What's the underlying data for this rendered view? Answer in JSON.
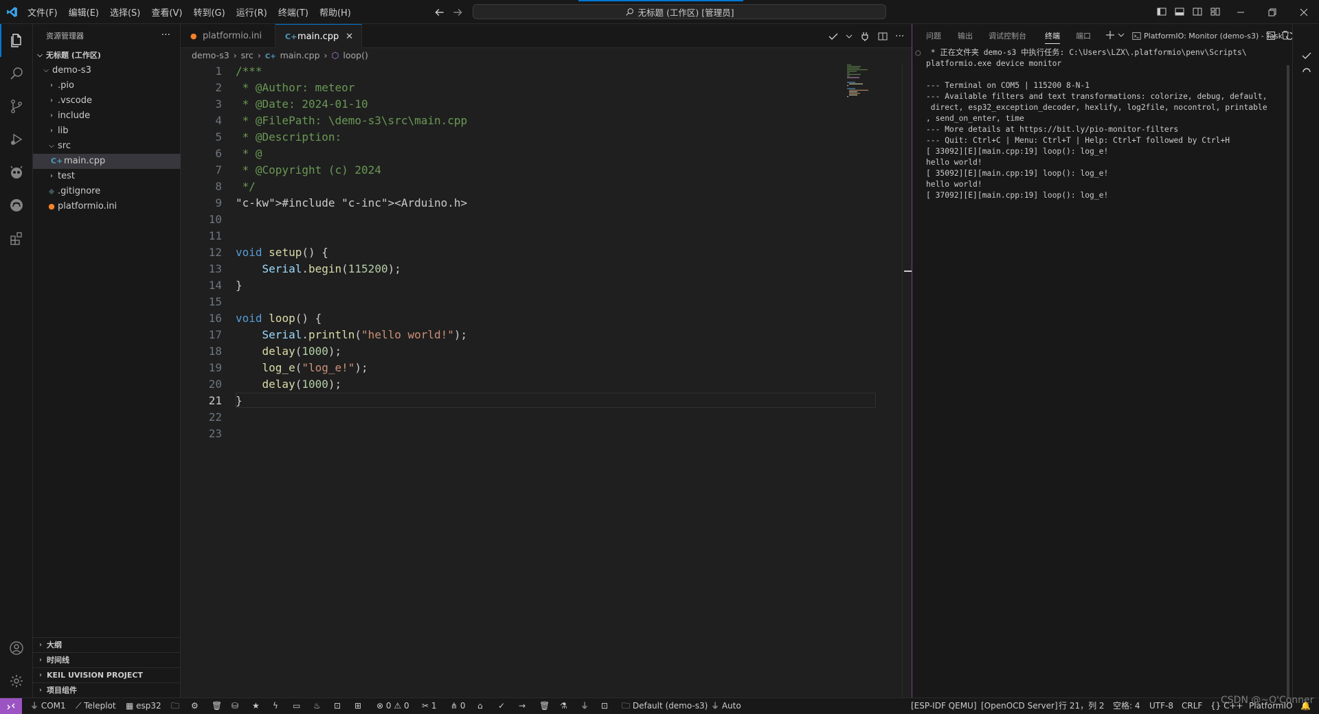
{
  "titlebar": {
    "menu": [
      "文件(F)",
      "编辑(E)",
      "选择(S)",
      "查看(V)",
      "转到(G)",
      "运行(R)",
      "终端(T)",
      "帮助(H)"
    ],
    "command_center": "无标题 (工作区) [管理员]"
  },
  "explorer": {
    "title": "资源管理器",
    "more": "···",
    "root": "无标题 (工作区)",
    "tree": [
      {
        "label": "demo-s3",
        "depth": 1,
        "chevron": "down"
      },
      {
        "label": ".pio",
        "depth": 2,
        "chevron": "right"
      },
      {
        "label": ".vscode",
        "depth": 2,
        "chevron": "right"
      },
      {
        "label": "include",
        "depth": 2,
        "chevron": "right"
      },
      {
        "label": "lib",
        "depth": 2,
        "chevron": "right"
      },
      {
        "label": "src",
        "depth": 2,
        "chevron": "down"
      },
      {
        "label": "main.cpp",
        "depth": 3,
        "icon": "cpp-file-icon"
      },
      {
        "label": "test",
        "depth": 2,
        "chevron": "right"
      },
      {
        "label": ".gitignore",
        "depth": 2,
        "icon": "git-file-icon"
      },
      {
        "label": "platformio.ini",
        "depth": 2,
        "icon": "platformio-file-icon"
      }
    ],
    "sections": [
      "大纲",
      "时间线",
      "KEIL UVISION PROJECT",
      "项目组件"
    ]
  },
  "editor": {
    "tabs": [
      {
        "label": "platformio.ini",
        "active": false
      },
      {
        "label": "main.cpp",
        "active": true,
        "close": "✕"
      }
    ],
    "breadcrumb": [
      "demo-s3",
      "src",
      "main.cpp",
      "loop()"
    ],
    "line_numbers": [
      "1",
      "2",
      "3",
      "4",
      "5",
      "6",
      "7",
      "8",
      "9",
      "10",
      "11",
      "12",
      "13",
      "14",
      "15",
      "16",
      "17",
      "18",
      "19",
      "20",
      "21",
      "22",
      "23"
    ],
    "current_line": 21,
    "code": [
      "/***",
      " * @Author: meteor",
      " * @Date: 2024-01-10",
      " * @FilePath: \\demo-s3\\src\\main.cpp",
      " * @Description:",
      " * @",
      " * @Copyright (c) 2024",
      " */",
      "#include <Arduino.h>",
      "",
      "",
      "void setup() {",
      "    Serial.begin(115200);",
      "}",
      "",
      "void loop() {",
      "    Serial.println(\"hello world!\");",
      "    delay(1000);",
      "    log_e(\"log_e!\");",
      "    delay(1000);",
      "}",
      "",
      ""
    ]
  },
  "panel": {
    "tabs": [
      "问题",
      "输出",
      "调试控制台",
      "终端",
      "端口"
    ],
    "active_tab": "终端",
    "task_title": "PlatformIO: Monitor (demo-s3) - Task",
    "terminal_lines": [
      " * 正在文件夹 demo-s3 中执行任务: C:\\Users\\LZX\\.platformio\\penv\\Scripts\\",
      "platformio.exe device monitor",
      "",
      "--- Terminal on COM5 | 115200 8-N-1",
      "--- Available filters and text transformations: colorize, debug, default,",
      " direct, esp32_exception_decoder, hexlify, log2file, nocontrol, printable",
      ", send_on_enter, time",
      "--- More details at https://bit.ly/pio-monitor-filters",
      "--- Quit: Ctrl+C | Menu: Ctrl+T | Help: Ctrl+T followed by Ctrl+H",
      "[ 33092][E][main.cpp:19] loop(): log_e!",
      "hello world!",
      "[ 35092][E][main.cpp:19] loop(): log_e!",
      "hello world!",
      "[ 37092][E][main.cpp:19] loop(): log_e!"
    ]
  },
  "statusbar": {
    "com": "COM1",
    "teleplot": "Teleplot",
    "board": "esp32",
    "errors": "0",
    "warnings": "0",
    "tools": "1",
    "ports": "0",
    "env": "Default (demo-s3)",
    "auto": "Auto",
    "esp_idf_qemu": "[ESP-IDF QEMU]",
    "openocd": "[OpenOCD Server]",
    "position": "行 21，列 2",
    "spaces": "空格: 4",
    "encoding": "UTF-8",
    "eol": "CRLF",
    "language": "C++",
    "platformio": "PlatformIO",
    "watermark": "CSDN @~O'Conner"
  },
  "colors": {
    "accent": "#0078d4",
    "remote": "#9c54c2",
    "panel_border": "#7a3fa0"
  }
}
